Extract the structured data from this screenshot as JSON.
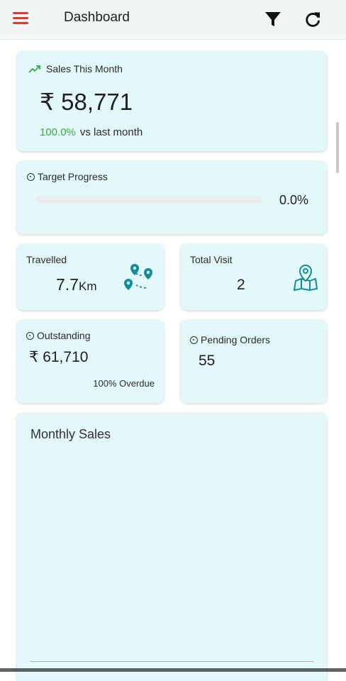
{
  "header": {
    "title": "Dashboard"
  },
  "sales": {
    "label": "Sales This Month",
    "value": "₹ 58,771",
    "change_pct": "100.0%",
    "change_text": "vs last month"
  },
  "target": {
    "label": "Target Progress",
    "progress": 0.0,
    "progress_text": "0.0%"
  },
  "travelled": {
    "label": "Travelled",
    "value": "7.7",
    "unit": "Km"
  },
  "total_visit": {
    "label": "Total Visit",
    "value": "2"
  },
  "outstanding": {
    "label": "Outstanding",
    "value": "₹ 61,710",
    "overdue": "100% Overdue"
  },
  "pending_orders": {
    "label": "Pending Orders",
    "value": "55"
  },
  "monthly_sales": {
    "title": "Monthly Sales"
  },
  "colors": {
    "accent": "#0e8e98",
    "menu": "#e23b2e",
    "card_bg": "#e3f8f8",
    "positive": "#3aa84a"
  },
  "icons": {
    "menu": "hamburger-icon",
    "filter": "filter-icon",
    "refresh": "refresh-icon",
    "trend": "trend-up-icon",
    "travel": "route-pins-icon",
    "visit": "map-pin-icon",
    "clock": "clock-icon"
  }
}
